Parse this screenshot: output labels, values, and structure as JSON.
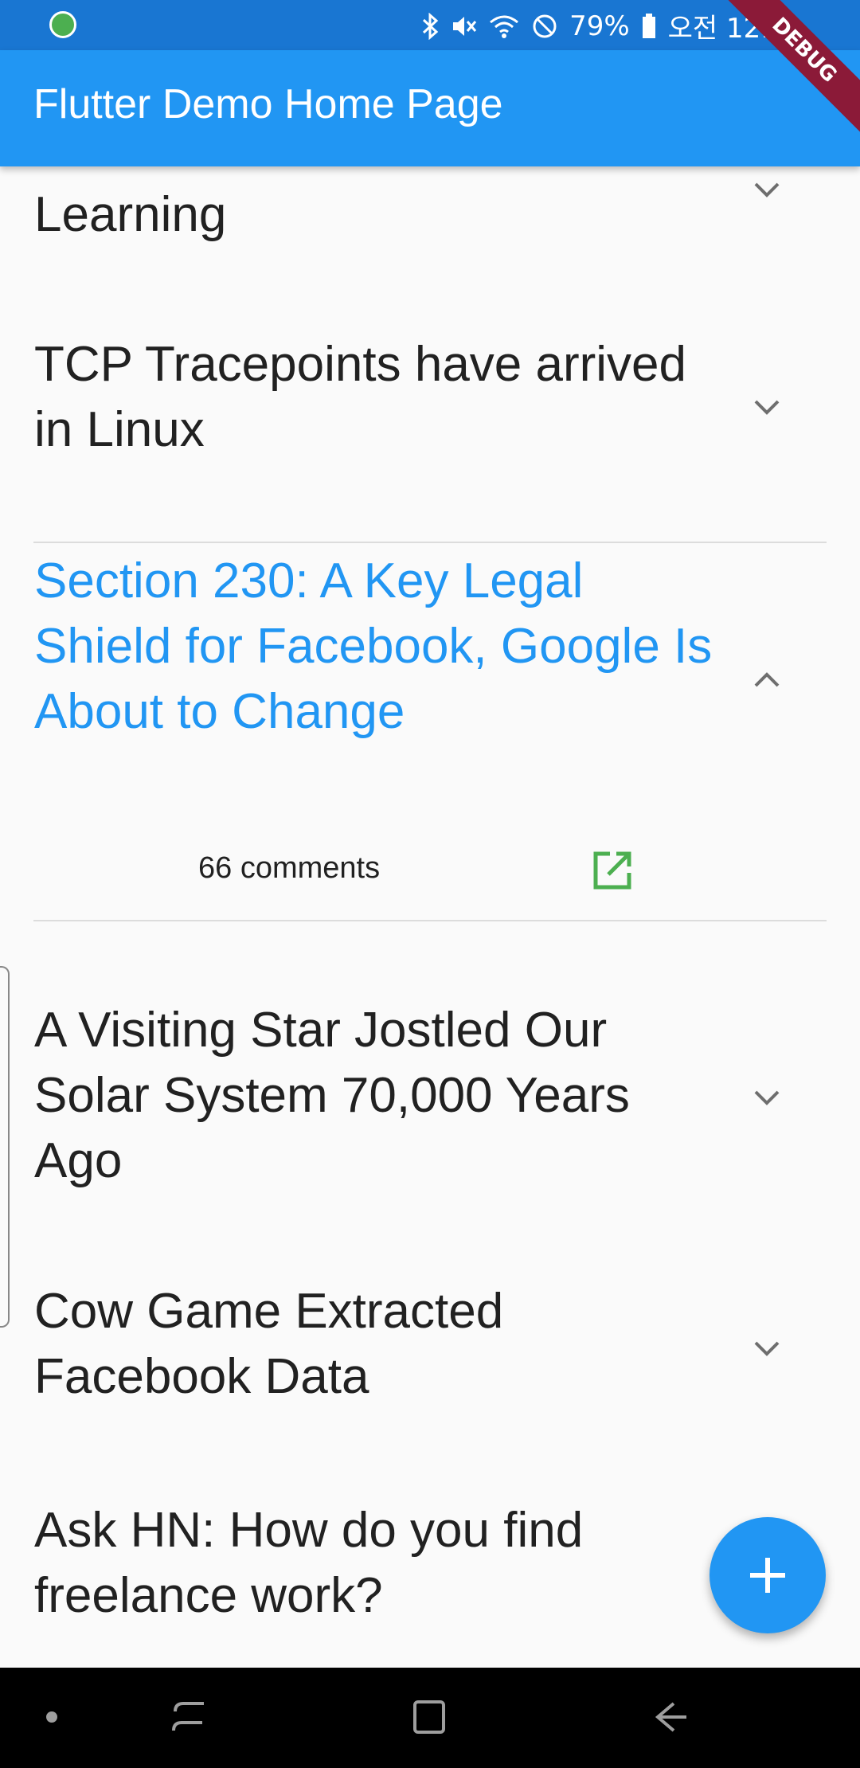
{
  "status_bar": {
    "battery": "79%",
    "time": "오전 12:51",
    "icons": [
      "bluetooth-icon",
      "mute-icon",
      "wifi-icon",
      "do-not-disturb-icon",
      "battery-icon"
    ]
  },
  "app_bar": {
    "title": "Flutter Demo Home Page",
    "debug_label": "DEBUG"
  },
  "list": {
    "items": [
      {
        "title": "Learning",
        "expanded": false
      },
      {
        "title": "TCP Tracepoints have arrived in Linux",
        "expanded": false
      },
      {
        "title": "Section 230: A Key Legal Shield for Facebook, Google Is About to Change",
        "expanded": true,
        "comments": "66 comments"
      },
      {
        "title": "A Visiting Star Jostled Our Solar System 70,000 Years Ago",
        "expanded": false
      },
      {
        "title": "Cow Game Extracted Facebook Data",
        "expanded": false
      },
      {
        "title": "Ask HN: How do you find freelance work?",
        "expanded": false
      }
    ]
  },
  "colors": {
    "primary": "#2196f3",
    "status_bar": "#1976d2",
    "open_link_icon": "#4caf50"
  }
}
